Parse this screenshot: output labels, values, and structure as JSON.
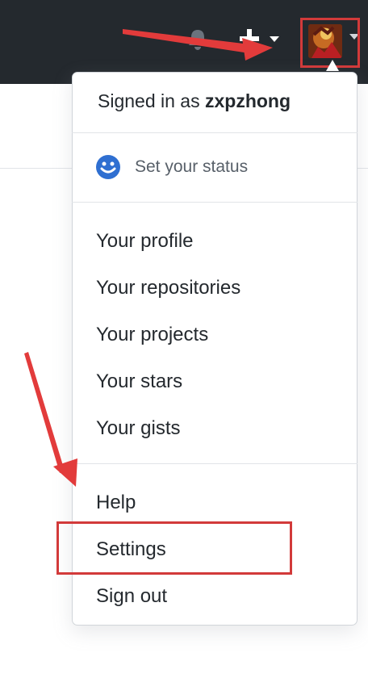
{
  "header": {
    "icons": {
      "notifications": "bell-icon",
      "create": "plus-icon",
      "avatar_caret": "chevron-down-icon"
    }
  },
  "dropdown": {
    "signed_in_prefix": "Signed in as",
    "username": "zxpzhong",
    "status": {
      "label": "Set your status",
      "icon": "smiley-icon"
    },
    "menu_items": [
      {
        "label": "Your profile"
      },
      {
        "label": "Your repositories"
      },
      {
        "label": "Your projects"
      },
      {
        "label": "Your stars"
      },
      {
        "label": "Your gists"
      }
    ],
    "footer_items": [
      {
        "label": "Help"
      },
      {
        "label": "Settings"
      },
      {
        "label": "Sign out"
      }
    ]
  },
  "colors": {
    "header_bg": "#24292e",
    "annotation_red": "#d23a3a",
    "status_icon_blue": "#2f6fd1"
  }
}
